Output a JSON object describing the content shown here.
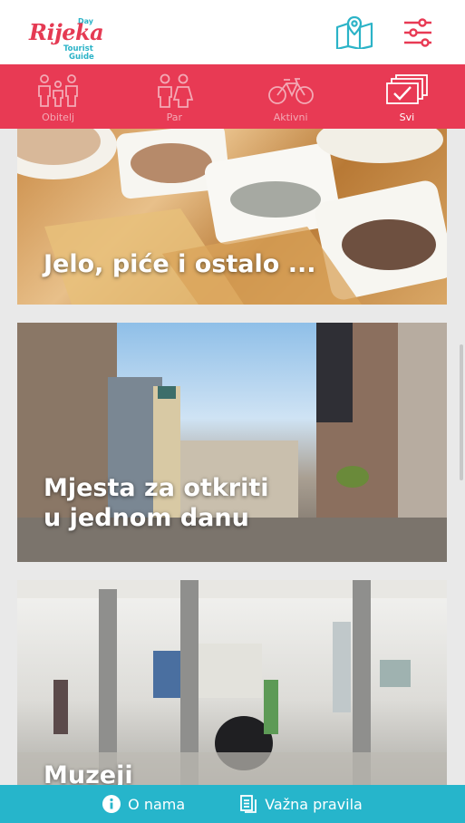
{
  "logo": {
    "day": "Day",
    "name": "Rijeka",
    "line1": "Tourist",
    "line2": "Guide"
  },
  "header": {
    "map_icon": "map-pin-icon",
    "settings_icon": "sliders-icon"
  },
  "filters": [
    {
      "label": "Obitelj",
      "icon": "family-icon",
      "active": false
    },
    {
      "label": "Par",
      "icon": "couple-icon",
      "active": false
    },
    {
      "label": "Aktivni",
      "icon": "bicycle-icon",
      "active": false
    },
    {
      "label": "Svi",
      "icon": "all-check-icon",
      "active": true
    }
  ],
  "cards": [
    {
      "title": "Jelo, piće i ostalo ..."
    },
    {
      "title": "Mjesta za otkriti\nu jednom danu"
    },
    {
      "title": "Muzeji"
    }
  ],
  "bottom": {
    "about_label": "O nama",
    "rules_label": "Važna pravila"
  },
  "colors": {
    "accent_red": "#e83a54",
    "accent_cyan": "#26b5cb"
  }
}
